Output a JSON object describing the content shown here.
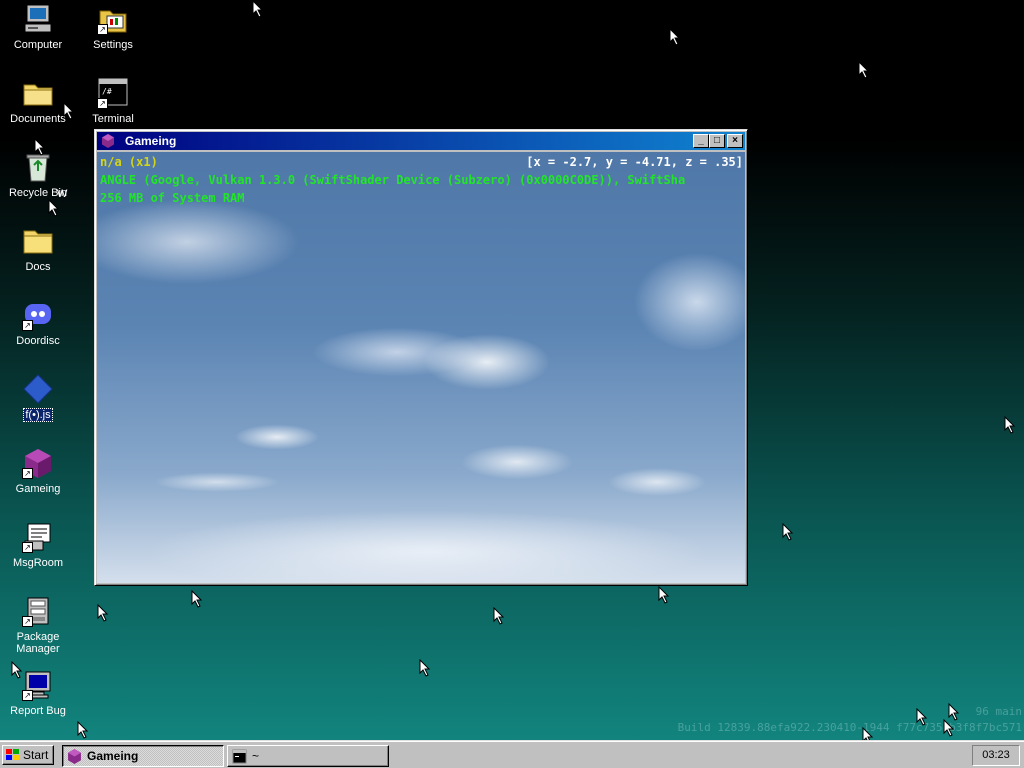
{
  "desktop": {
    "icons": [
      {
        "label": "Computer",
        "icon": "computer-icon"
      },
      {
        "label": "Settings",
        "icon": "settings-icon"
      },
      {
        "label": "Documents",
        "icon": "folder-icon"
      },
      {
        "label": "Terminal",
        "icon": "terminal-icon"
      },
      {
        "label": "Recycle Bin",
        "icon": "recycle-bin-icon"
      },
      {
        "label": "Docs",
        "icon": "folder-icon"
      },
      {
        "label": "Doordisc",
        "icon": "doordisc-icon"
      },
      {
        "label": "f(•).js",
        "icon": "diamond-icon"
      },
      {
        "label": "Gameing",
        "icon": "purple-cube-icon"
      },
      {
        "label": "MsgRoom",
        "icon": "msgroom-icon"
      },
      {
        "label": "Package Manager",
        "icon": "package-manager-icon"
      },
      {
        "label": "Report Bug",
        "icon": "report-bug-icon"
      }
    ],
    "partial_label": "W",
    "build_line1": "96 main",
    "build_line2": "Build 12839.88efa922.230410-1944 f77c735eb3f8f7bc571"
  },
  "window": {
    "title": "Gameing",
    "minimize_label": "_",
    "maximize_label": "□",
    "close_label": "×",
    "hud": {
      "fps": "n/a (x1)",
      "coords": "[x = -2.7, y = -4.71, z = .35]",
      "gpu": "ANGLE (Google, Vulkan 1.3.0 (SwiftShader Device (Subzero) (0x0000C0DE)), SwiftSha",
      "ram": "256 MB of System RAM"
    }
  },
  "taskbar": {
    "start_label": "Start",
    "tasks": [
      {
        "label": "Gameing",
        "active": true
      },
      {
        "label": "~",
        "active": false
      }
    ],
    "clock": "03:23"
  },
  "colors": {
    "title_gradient_start": "#000080",
    "title_gradient_end": "#1084d0",
    "hud_yellow": "#d4d419",
    "hud_green": "#22e52a",
    "desktop_teal": "#138a83"
  }
}
